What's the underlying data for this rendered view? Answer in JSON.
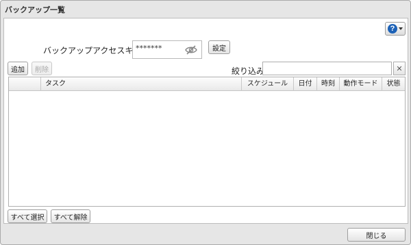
{
  "dialog": {
    "title": "バックアップ一覧"
  },
  "help": {
    "icon_text": "?"
  },
  "access_key": {
    "label": "バックアップアクセスキー:",
    "value": "*******",
    "set_button": "設定"
  },
  "toolbar": {
    "add": "追加",
    "delete": "削除",
    "filter_label": "絞り込み:",
    "filter_value": "",
    "clear": "✕"
  },
  "table": {
    "columns": [
      "",
      "タスク",
      "スケジュール",
      "日付",
      "時刻",
      "動作モード",
      "状態"
    ],
    "rows": []
  },
  "footer": {
    "select_all": "すべて選択",
    "deselect_all": "すべて解除",
    "close": "閉じる"
  }
}
